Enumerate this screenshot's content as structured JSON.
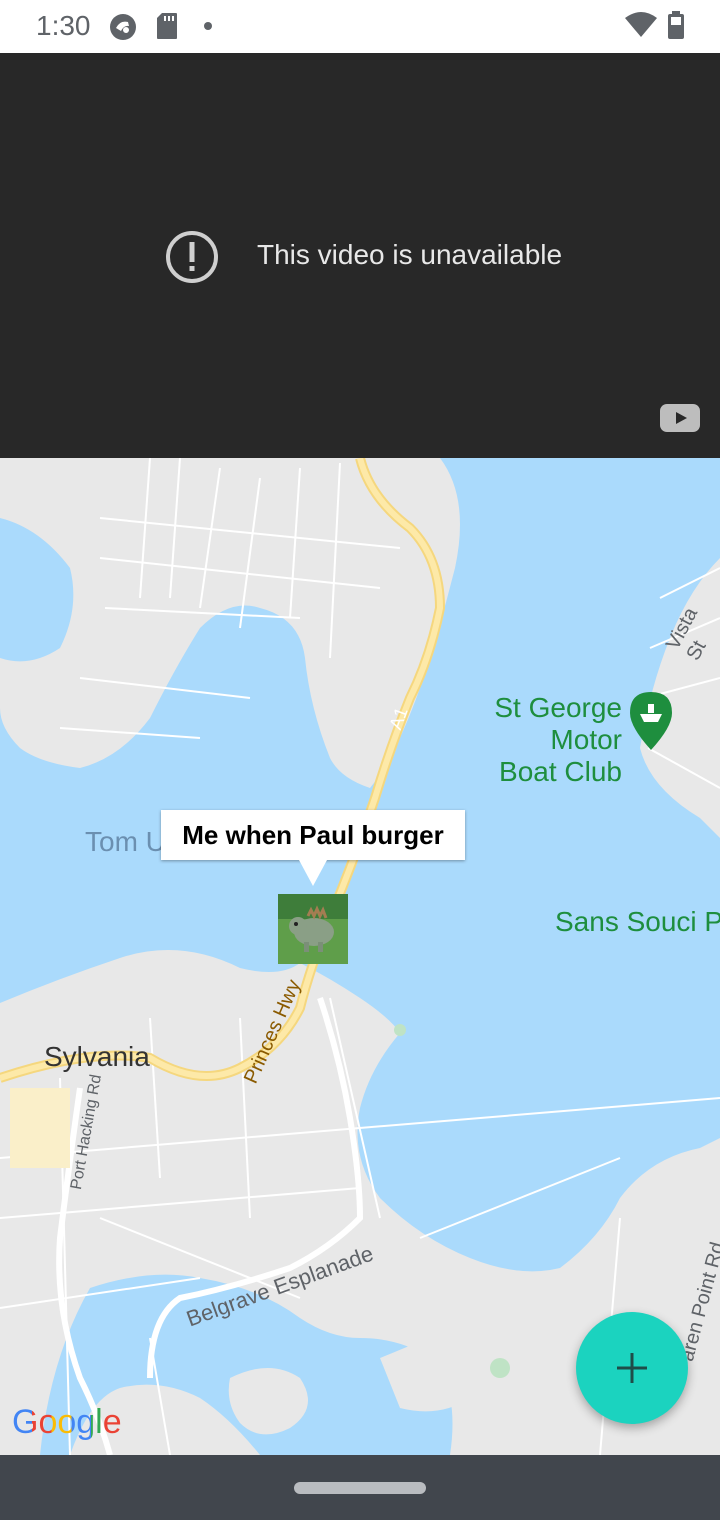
{
  "status_bar": {
    "time": "1:30"
  },
  "video": {
    "message": "This video is unavailable"
  },
  "map": {
    "labels": {
      "st_george": "St George Motor",
      "st_george_2": "Boat Club",
      "vista_st": "Vista St",
      "tom_u": "Tom U",
      "sans_souci": "Sans Souci Pa",
      "sylvania": "Sylvania",
      "princes_hwy": "Princes Hwy",
      "port_hacking": "Port Hacking Rd",
      "belgrave": "Belgrave Esplanade",
      "karen_point": "aren Point Rd",
      "a1": "A1"
    },
    "info_bubble": "Me when Paul burger",
    "attribution": "Google"
  },
  "colors": {
    "fab": "#1bd3bf",
    "water": "#aadafc",
    "land": "#e8e8e8",
    "road_major": "#fbe18f",
    "poi_green": "#1e8e3e"
  },
  "icons": [
    "camera-icon",
    "sd-card-icon",
    "dot-icon",
    "wifi-icon",
    "battery-icon",
    "alert-circle-icon",
    "youtube-icon",
    "boat-pin-icon",
    "plus-icon"
  ]
}
